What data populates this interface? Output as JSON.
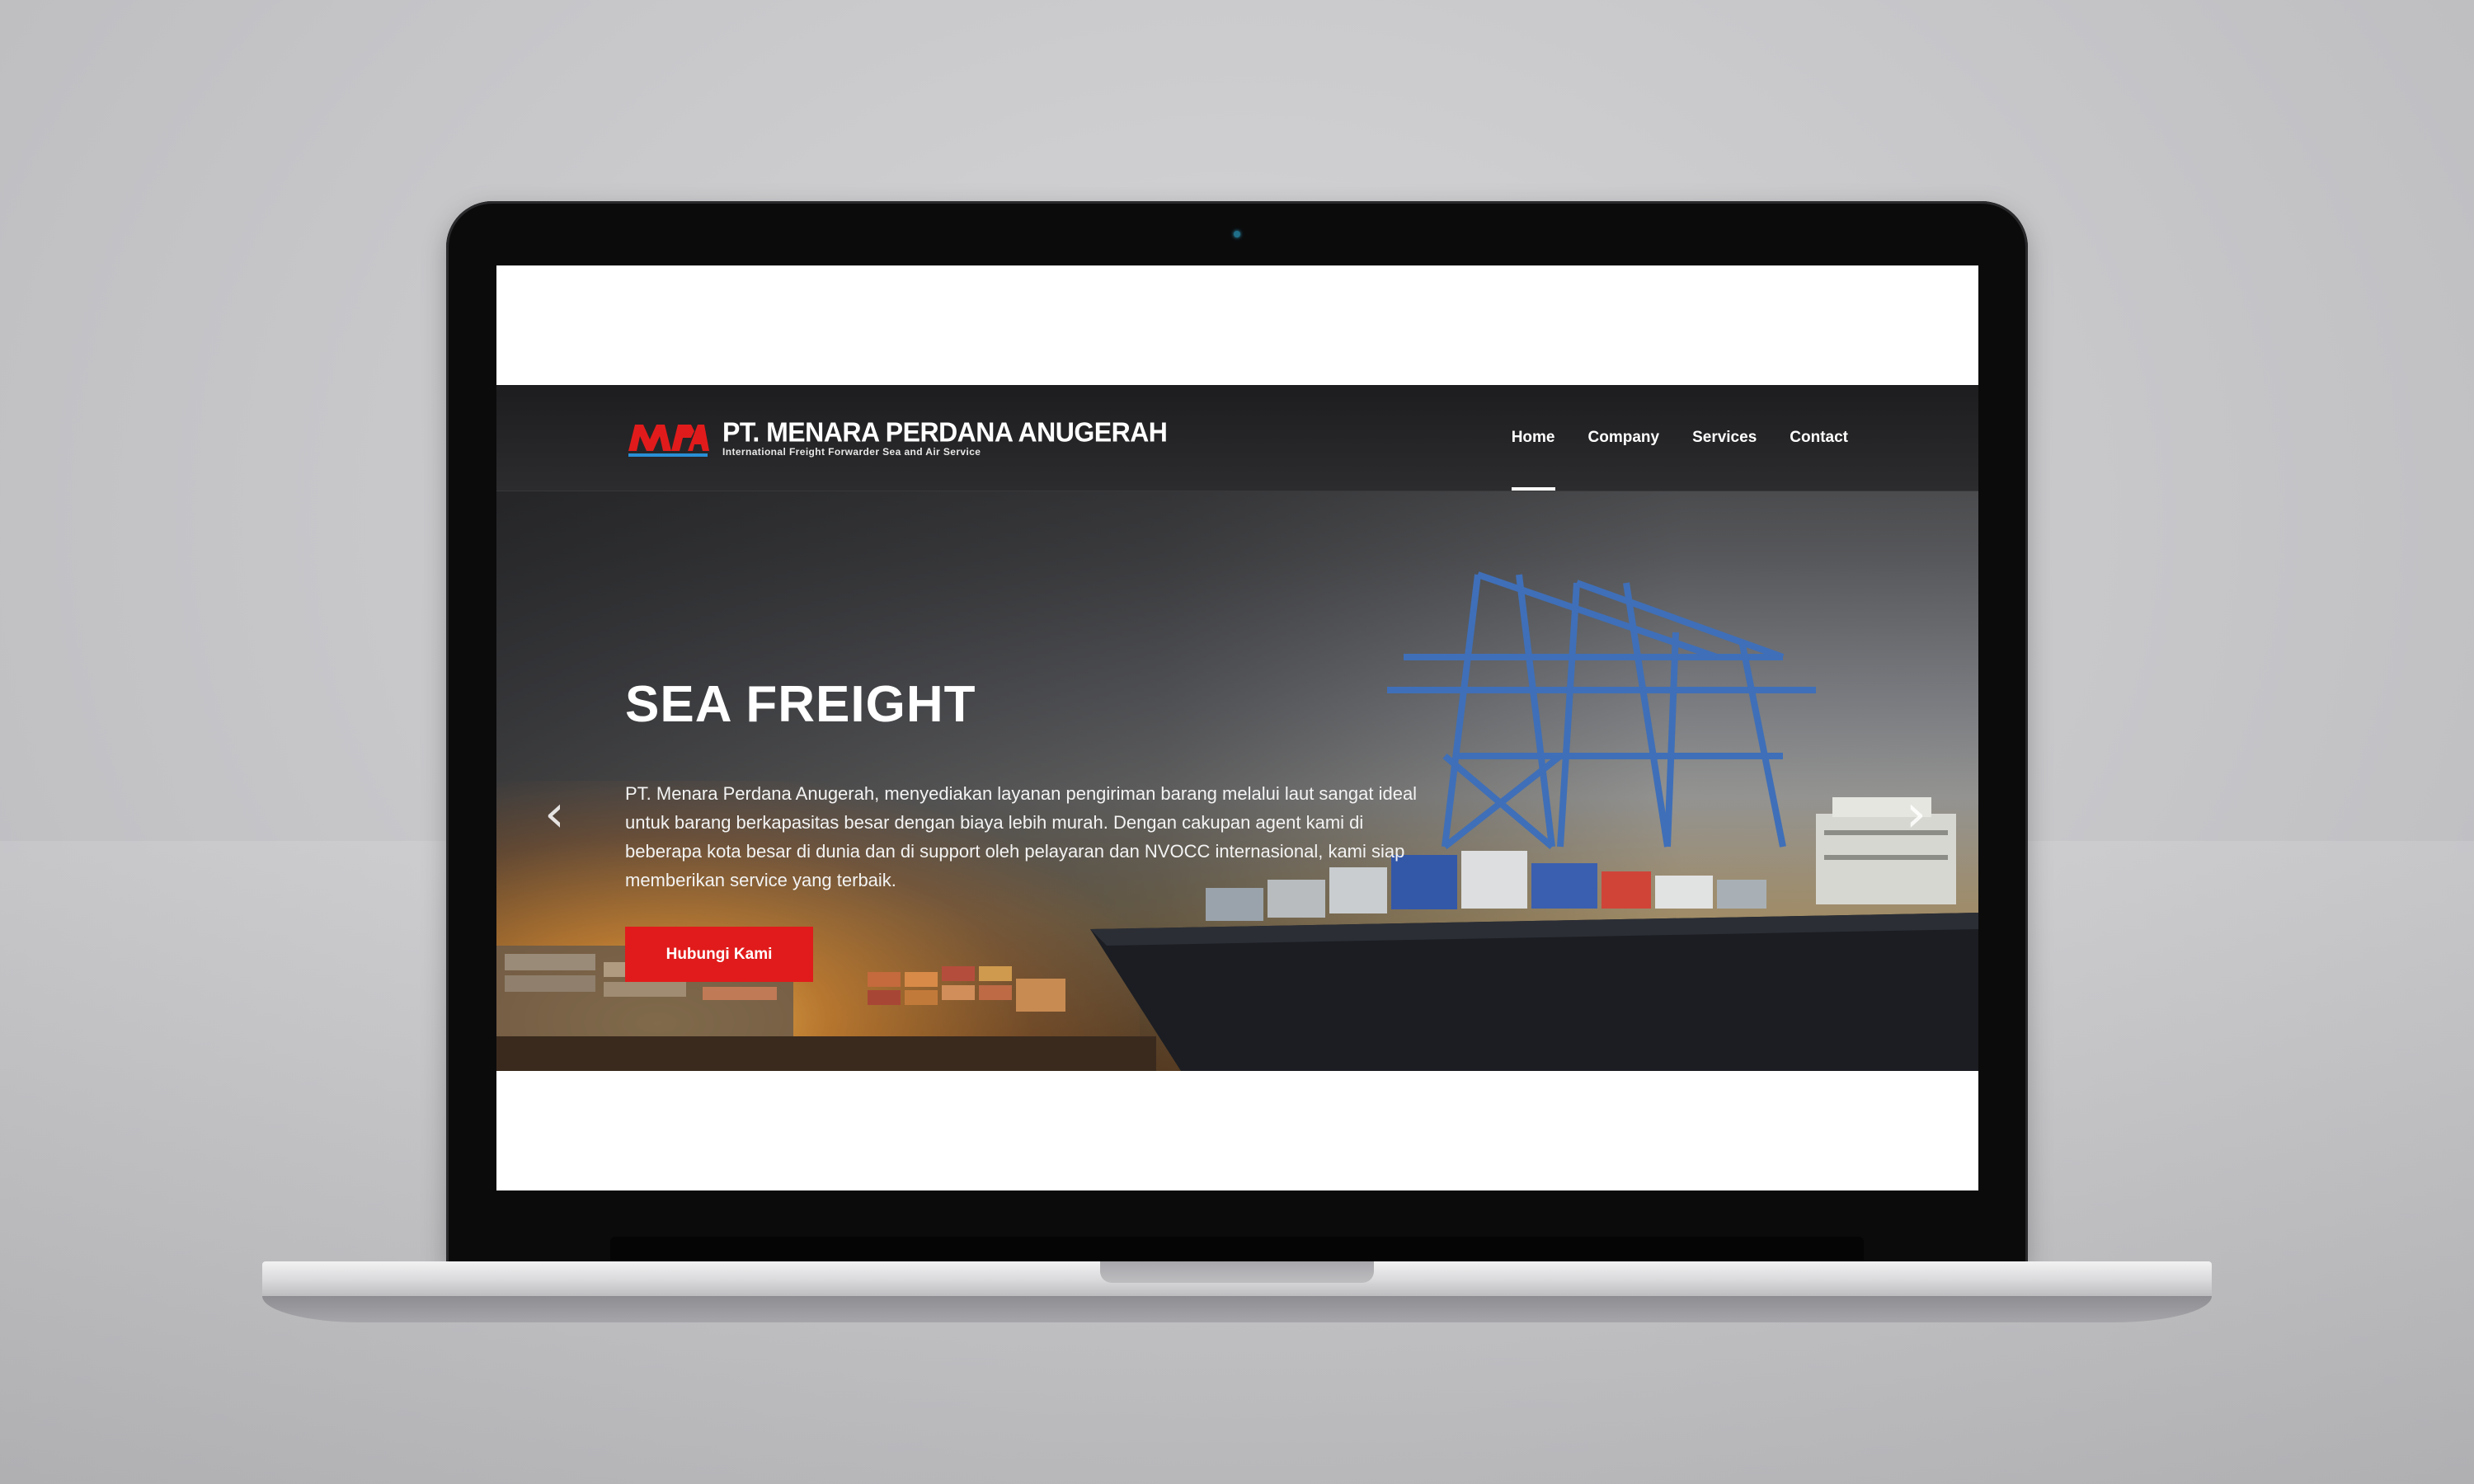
{
  "brand": {
    "name": "PT. MENARA PERDANA ANUGERAH",
    "tagline": "International Freight Forwarder Sea and Air Service",
    "logo_letters": "MPA",
    "accent": "#e11b1b",
    "logo_blue": "#2a8fd6"
  },
  "nav": {
    "items": [
      {
        "label": "Home",
        "active": true
      },
      {
        "label": "Company",
        "active": false
      },
      {
        "label": "Services",
        "active": false
      },
      {
        "label": "Contact",
        "active": false
      }
    ]
  },
  "hero": {
    "title": "SEA FREIGHT",
    "description": "PT. Menara Perdana Anugerah, menyediakan layanan pengiriman barang melalui laut sangat ideal untuk barang berkapasitas besar dengan biaya lebih murah. Dengan cakupan agent kami di beberapa kota besar di dunia dan di support oleh pelayaran dan NVOCC internasional, kami siap memberikan service yang terbaik.",
    "cta_label": "Hubungi Kami",
    "prev_icon": "chevron-left-icon",
    "next_icon": "chevron-right-icon"
  }
}
